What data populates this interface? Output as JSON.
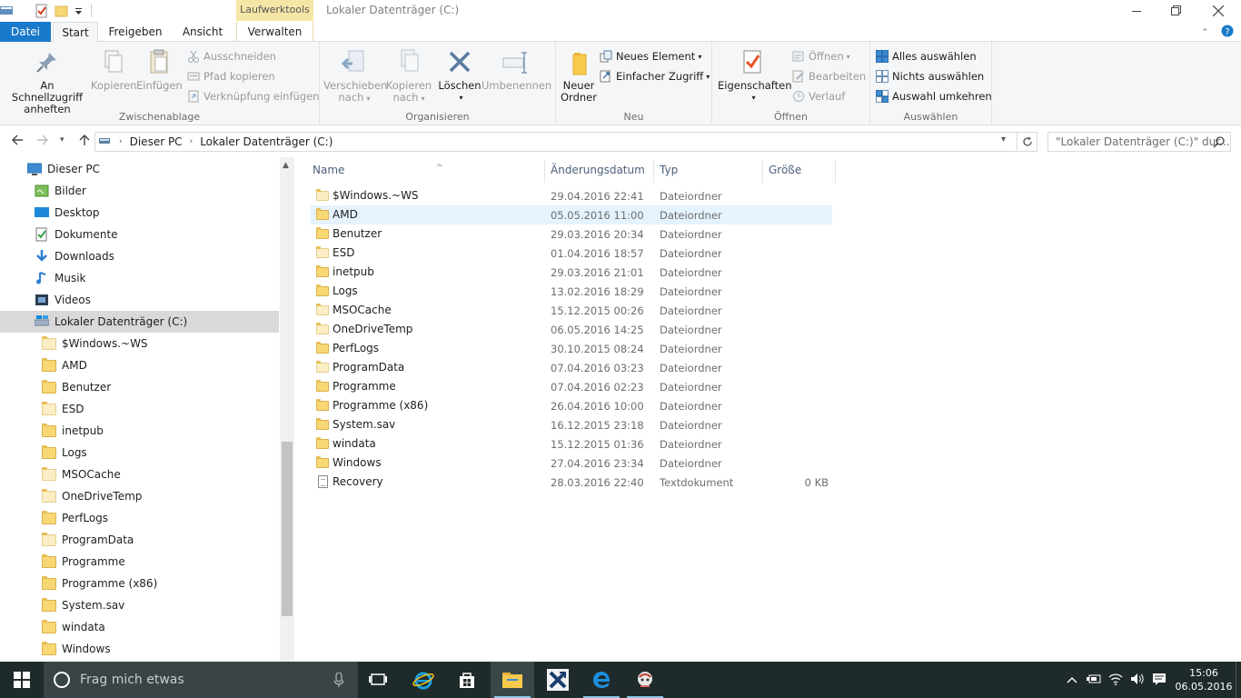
{
  "window": {
    "title": "Lokaler Datenträger (C:)",
    "contextual_tab": "Laufwerktools"
  },
  "tabs": [
    {
      "label": "Datei"
    },
    {
      "label": "Start"
    },
    {
      "label": "Freigeben"
    },
    {
      "label": "Ansicht"
    },
    {
      "label": "Verwalten"
    }
  ],
  "ribbon": {
    "zwischenablage": {
      "label": "Zwischenablage",
      "pin_line1": "An Schnellzugriff",
      "pin_line2": "anheften",
      "copy": "Kopieren",
      "paste": "Einfügen",
      "cut": "Ausschneiden",
      "copy_path": "Pfad kopieren",
      "paste_shortcut": "Verknüpfung einfügen"
    },
    "organisieren": {
      "label": "Organisieren",
      "move_line1": "Verschieben",
      "move_line2": "nach",
      "copyto_line1": "Kopieren",
      "copyto_line2": "nach",
      "delete": "Löschen",
      "rename": "Umbenennen"
    },
    "neu": {
      "label": "Neu",
      "new_folder_line1": "Neuer",
      "new_folder_line2": "Ordner",
      "new_item": "Neues Element",
      "easy_access": "Einfacher Zugriff"
    },
    "oeffnen": {
      "label": "Öffnen",
      "properties": "Eigenschaften",
      "open": "Öffnen",
      "edit": "Bearbeiten",
      "history": "Verlauf"
    },
    "auswaehlen": {
      "label": "Auswählen",
      "select_all": "Alles auswählen",
      "select_none": "Nichts auswählen",
      "invert": "Auswahl umkehren"
    }
  },
  "address": {
    "crumbs": [
      "Dieser PC",
      "Lokaler Datenträger (C:)"
    ],
    "search_placeholder": "\"Lokaler Datenträger (C:)\" dur..."
  },
  "navpane": {
    "items": [
      {
        "label": "Dieser PC",
        "icon": "pc-icon",
        "level": 0
      },
      {
        "label": "Bilder",
        "icon": "pictures-icon",
        "level": 1
      },
      {
        "label": "Desktop",
        "icon": "desktop-icon",
        "level": 1
      },
      {
        "label": "Dokumente",
        "icon": "documents-icon",
        "level": 1
      },
      {
        "label": "Downloads",
        "icon": "downloads-icon",
        "level": 1
      },
      {
        "label": "Musik",
        "icon": "music-icon",
        "level": 1
      },
      {
        "label": "Videos",
        "icon": "videos-icon",
        "level": 1
      },
      {
        "label": "Lokaler Datenträger (C:)",
        "icon": "drive-icon",
        "level": 1,
        "selected": true
      },
      {
        "label": "$Windows.~WS",
        "icon": "folder-icon",
        "level": 2,
        "pale": true
      },
      {
        "label": "AMD",
        "icon": "folder-icon",
        "level": 2
      },
      {
        "label": "Benutzer",
        "icon": "folder-icon",
        "level": 2
      },
      {
        "label": "ESD",
        "icon": "folder-icon",
        "level": 2,
        "pale": true
      },
      {
        "label": "inetpub",
        "icon": "folder-icon",
        "level": 2
      },
      {
        "label": "Logs",
        "icon": "folder-icon",
        "level": 2
      },
      {
        "label": "MSOCache",
        "icon": "folder-icon",
        "level": 2,
        "pale": true
      },
      {
        "label": "OneDriveTemp",
        "icon": "folder-icon",
        "level": 2,
        "pale": true
      },
      {
        "label": "PerfLogs",
        "icon": "folder-icon",
        "level": 2
      },
      {
        "label": "ProgramData",
        "icon": "folder-icon",
        "level": 2,
        "pale": true
      },
      {
        "label": "Programme",
        "icon": "folder-icon",
        "level": 2
      },
      {
        "label": "Programme (x86)",
        "icon": "folder-icon",
        "level": 2
      },
      {
        "label": "System.sav",
        "icon": "folder-icon",
        "level": 2
      },
      {
        "label": "windata",
        "icon": "folder-icon",
        "level": 2
      },
      {
        "label": "Windows",
        "icon": "folder-icon",
        "level": 2
      }
    ]
  },
  "filelist": {
    "columns": [
      "Name",
      "Änderungsdatum",
      "Typ",
      "Größe"
    ],
    "rows": [
      {
        "name": "$Windows.~WS",
        "date": "29.04.2016 22:41",
        "type": "Dateiordner",
        "size": "",
        "kind": "folder",
        "pale": true
      },
      {
        "name": "AMD",
        "date": "05.05.2016 11:00",
        "type": "Dateiordner",
        "size": "",
        "kind": "folder",
        "hover": true
      },
      {
        "name": "Benutzer",
        "date": "29.03.2016 20:34",
        "type": "Dateiordner",
        "size": "",
        "kind": "folder"
      },
      {
        "name": "ESD",
        "date": "01.04.2016 18:57",
        "type": "Dateiordner",
        "size": "",
        "kind": "folder",
        "pale": true
      },
      {
        "name": "inetpub",
        "date": "29.03.2016 21:01",
        "type": "Dateiordner",
        "size": "",
        "kind": "folder"
      },
      {
        "name": "Logs",
        "date": "13.02.2016 18:29",
        "type": "Dateiordner",
        "size": "",
        "kind": "folder"
      },
      {
        "name": "MSOCache",
        "date": "15.12.2015 00:26",
        "type": "Dateiordner",
        "size": "",
        "kind": "folder",
        "pale": true
      },
      {
        "name": "OneDriveTemp",
        "date": "06.05.2016 14:25",
        "type": "Dateiordner",
        "size": "",
        "kind": "folder",
        "pale": true
      },
      {
        "name": "PerfLogs",
        "date": "30.10.2015 08:24",
        "type": "Dateiordner",
        "size": "",
        "kind": "folder"
      },
      {
        "name": "ProgramData",
        "date": "07.04.2016 03:23",
        "type": "Dateiordner",
        "size": "",
        "kind": "folder",
        "pale": true
      },
      {
        "name": "Programme",
        "date": "07.04.2016 02:23",
        "type": "Dateiordner",
        "size": "",
        "kind": "folder"
      },
      {
        "name": "Programme (x86)",
        "date": "26.04.2016 10:00",
        "type": "Dateiordner",
        "size": "",
        "kind": "folder"
      },
      {
        "name": "System.sav",
        "date": "16.12.2015 23:18",
        "type": "Dateiordner",
        "size": "",
        "kind": "folder"
      },
      {
        "name": "windata",
        "date": "15.12.2015 01:36",
        "type": "Dateiordner",
        "size": "",
        "kind": "folder"
      },
      {
        "name": "Windows",
        "date": "27.04.2016 23:34",
        "type": "Dateiordner",
        "size": "",
        "kind": "folder"
      },
      {
        "name": "Recovery",
        "date": "28.03.2016 22:40",
        "type": "Textdokument",
        "size": "0 KB",
        "kind": "text"
      }
    ]
  },
  "taskbar": {
    "search_placeholder": "Frag mich etwas",
    "time": "15:06",
    "date": "06.05.2016"
  },
  "colors": {
    "accent": "#1979ca",
    "taskbar": "#1f2a2b",
    "folder": "#f8d775",
    "hover_row": "#e5f3ff"
  }
}
